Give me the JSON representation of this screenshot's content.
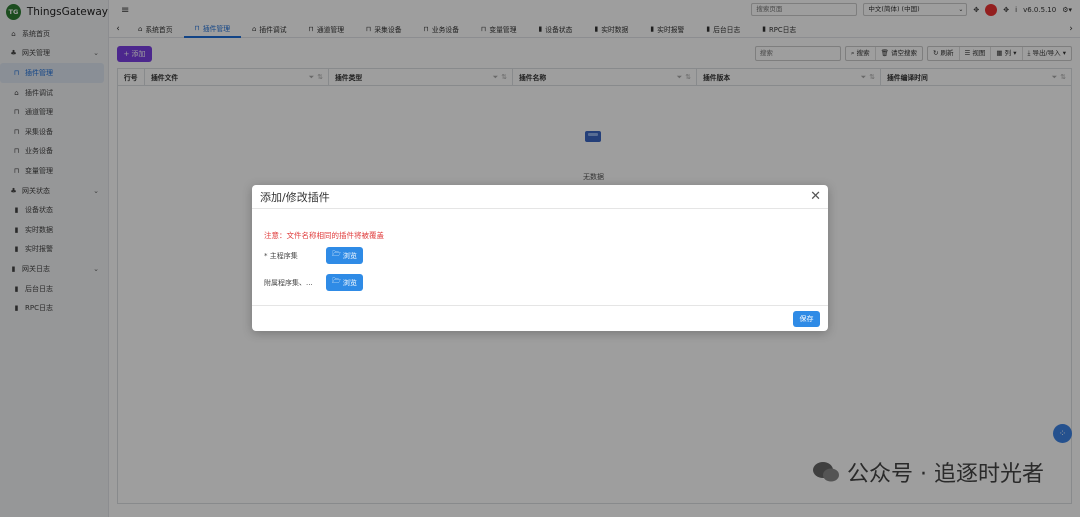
{
  "app": {
    "logo": "TG",
    "name": "ThingsGateway",
    "menu_icon": "hamburger-icon"
  },
  "sidebar": {
    "items": [
      {
        "label": "系统首页",
        "icon": "home-icon"
      },
      {
        "label": "网关管理",
        "icon": "group-icon"
      },
      {
        "label": "插件管理",
        "icon": "network-icon"
      },
      {
        "label": "插件调试",
        "icon": "home-icon"
      },
      {
        "label": "通道管理",
        "icon": "network-icon"
      },
      {
        "label": "采集设备",
        "icon": "network-icon"
      },
      {
        "label": "业务设备",
        "icon": "network-icon"
      },
      {
        "label": "变量管理",
        "icon": "network-icon"
      },
      {
        "label": "网关状态",
        "icon": "group-icon"
      },
      {
        "label": "设备状态",
        "icon": "book-icon"
      },
      {
        "label": "实时数据",
        "icon": "book-icon"
      },
      {
        "label": "实时报警",
        "icon": "book-icon"
      },
      {
        "label": "网关日志",
        "icon": "book-icon"
      },
      {
        "label": "后台日志",
        "icon": "book-icon"
      },
      {
        "label": "RPC日志",
        "icon": "book-icon"
      }
    ]
  },
  "header": {
    "search_placeholder": "搜索页面",
    "language": "中文(简体) (中国)",
    "version": "v6.0.5.10"
  },
  "tabs": [
    "系统首页",
    "插件管理",
    "插件调试",
    "通道管理",
    "采集设备",
    "业务设备",
    "变量管理",
    "设备状态",
    "实时数据",
    "实时报警",
    "后台日志",
    "RPC日志"
  ],
  "toolbar": {
    "add_label": "+ 添加",
    "search_placeholder": "搜索",
    "search_btn": "搜索",
    "clear_btn": "请空搜索",
    "refresh_btn": "刷新",
    "view_btn": "视图",
    "columns_btn": "列",
    "export_btn": "导出/导入"
  },
  "grid": {
    "columns": [
      "行号",
      "插件文件",
      "插件类型",
      "插件名称",
      "插件版本",
      "插件编译时间"
    ],
    "empty_text": "无数据"
  },
  "modal": {
    "title": "添加/修改插件",
    "note": "注意：文件名称相同的插件将被覆盖",
    "rows": [
      {
        "label": "* 主程序集",
        "button": "浏览"
      },
      {
        "label": "附属程序集、...",
        "button": "浏览"
      }
    ],
    "save": "保存"
  },
  "watermark": "公众号 · 追逐时光者"
}
